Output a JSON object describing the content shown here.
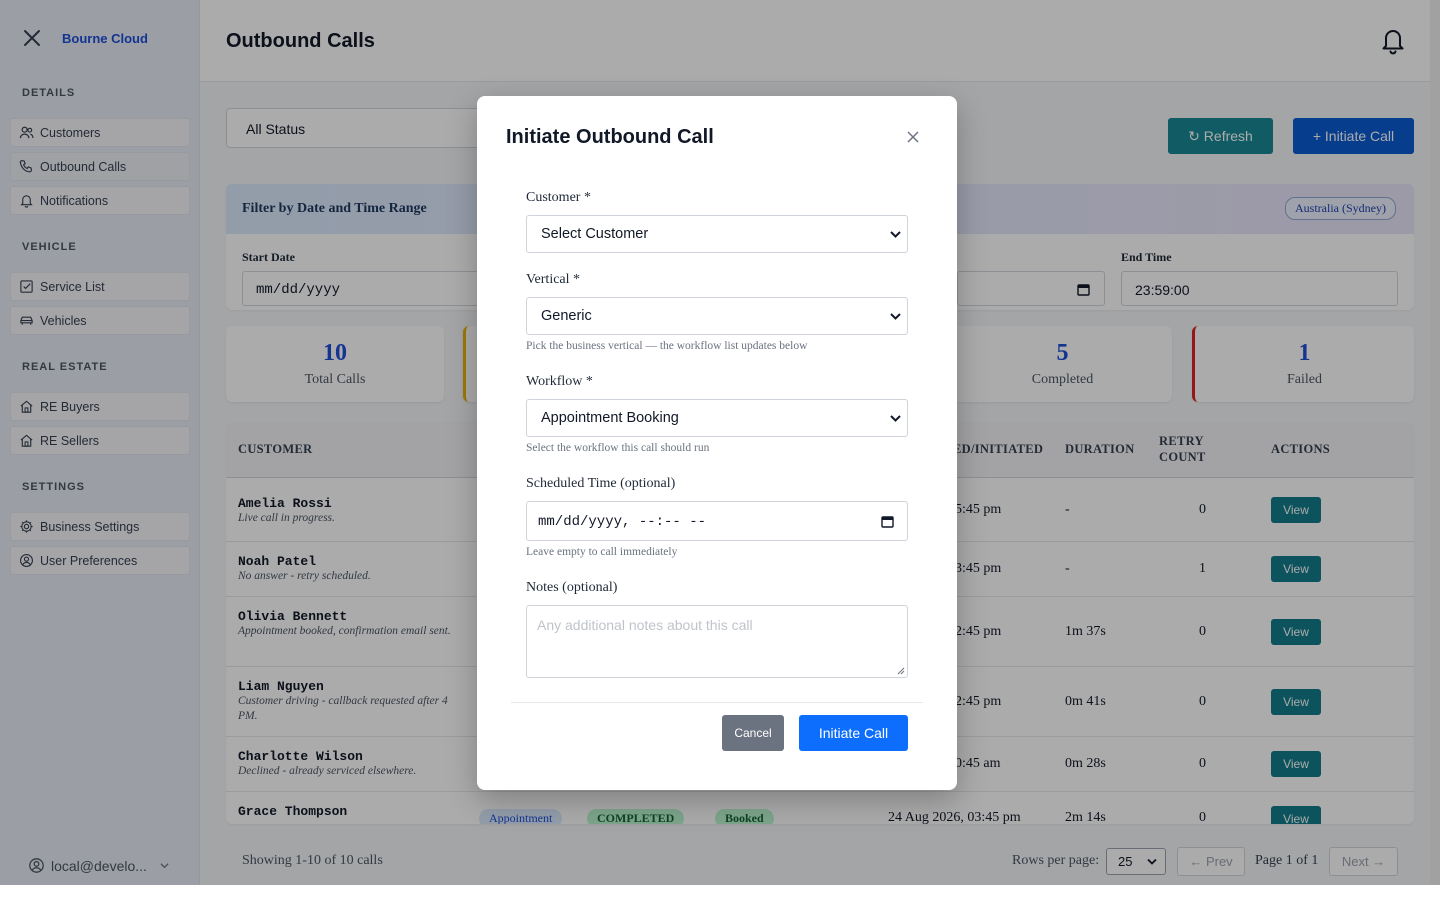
{
  "sidebar": {
    "brand": "Bourne Cloud",
    "sections": {
      "details": "DETAILS",
      "vehicle": "VEHICLE",
      "real_estate": "REAL ESTATE",
      "settings": "SETTINGS"
    },
    "items": {
      "customers": "Customers",
      "outbound_calls": "Outbound Calls",
      "notifications": "Notifications",
      "service_list": "Service List",
      "vehicles": "Vehicles",
      "re_buyers": "RE Buyers",
      "re_sellers": "RE Sellers",
      "business_settings": "Business Settings",
      "user_preferences": "User Preferences"
    },
    "user": "local@develo..."
  },
  "header": {
    "title": "Outbound Calls"
  },
  "toolbar": {
    "status_filter": "All Status",
    "refresh_label": "↻ Refresh",
    "initiate_label": "+ Initiate Call"
  },
  "date_filter": {
    "title": "Filter by Date and Time Range",
    "timezone": "Australia (Sydney)",
    "start_date_label": "Start Date",
    "start_date_value": "mm/dd/yyyy",
    "end_time_label": "End Time",
    "end_time_value": "23:59:00"
  },
  "stats": {
    "total": {
      "value": "10",
      "label": "Total Calls"
    },
    "completed": {
      "value": "5",
      "label": "Completed"
    },
    "failed": {
      "value": "1",
      "label": "Failed"
    }
  },
  "table": {
    "headers": {
      "customer": "CUSTOMER",
      "initiated": "ED/INITIATED",
      "duration": "DURATION",
      "retry_line1": "RETRY",
      "retry_line2": "COUNT",
      "actions": "ACTIONS"
    },
    "view_label": "View",
    "rows": [
      {
        "name": "Amelia Rossi",
        "note": "Live call in progress.",
        "initiated": ", 05:45 pm",
        "duration": "-",
        "retry": "0"
      },
      {
        "name": "Noah Patel",
        "note": "No answer - retry scheduled.",
        "initiated": ", 03:45 pm",
        "duration": "-",
        "retry": "1"
      },
      {
        "name": "Olivia Bennett",
        "note": "Appointment booked, confirmation email sent.",
        "initiated": ", 02:45 pm",
        "duration": "1m 37s",
        "retry": "0"
      },
      {
        "name": "Liam Nguyen",
        "note": "Customer driving - callback requested after 4 PM.",
        "initiated": ", 12:45 pm",
        "duration": "0m 41s",
        "retry": "0"
      },
      {
        "name": "Charlotte Wilson",
        "note": "Declined - already serviced elsewhere.",
        "initiated": ", 10:45 am",
        "duration": "0m 28s",
        "retry": "0"
      },
      {
        "name": "Grace Thompson",
        "vertical": "Appointment",
        "status": "COMPLETED",
        "outcome": "Booked",
        "initiated": "24 Aug 2026, 03:45 pm",
        "duration": "2m 14s",
        "retry": "0"
      }
    ]
  },
  "pagination": {
    "showing": "Showing 1-10 of 10 calls",
    "rows_per_page_label": "Rows per page:",
    "rows_per_page": "25",
    "prev": "← Prev",
    "page_info": "Page 1 of 1",
    "next": "Next →"
  },
  "modal": {
    "title": "Initiate Outbound Call",
    "customer_label": "Customer *",
    "customer_value": "Select Customer",
    "vertical_label": "Vertical *",
    "vertical_value": "Generic",
    "vertical_help": "Pick the business vertical — the workflow list updates below",
    "workflow_label": "Workflow *",
    "workflow_value": "Appointment Booking",
    "workflow_help": "Select the workflow this call should run",
    "scheduled_label": "Scheduled Time (optional)",
    "scheduled_value": "mm/dd/yyyy, --:-- --",
    "scheduled_help": "Leave empty to call immediately",
    "notes_label": "Notes (optional)",
    "notes_placeholder": "Any additional notes about this call",
    "cancel_label": "Cancel",
    "submit_label": "Initiate Call"
  },
  "colors": {
    "primary": "#0d6efd",
    "teal": "#1a8a96",
    "failed_accent": "#dc2626",
    "pending_accent": "#eab308"
  }
}
